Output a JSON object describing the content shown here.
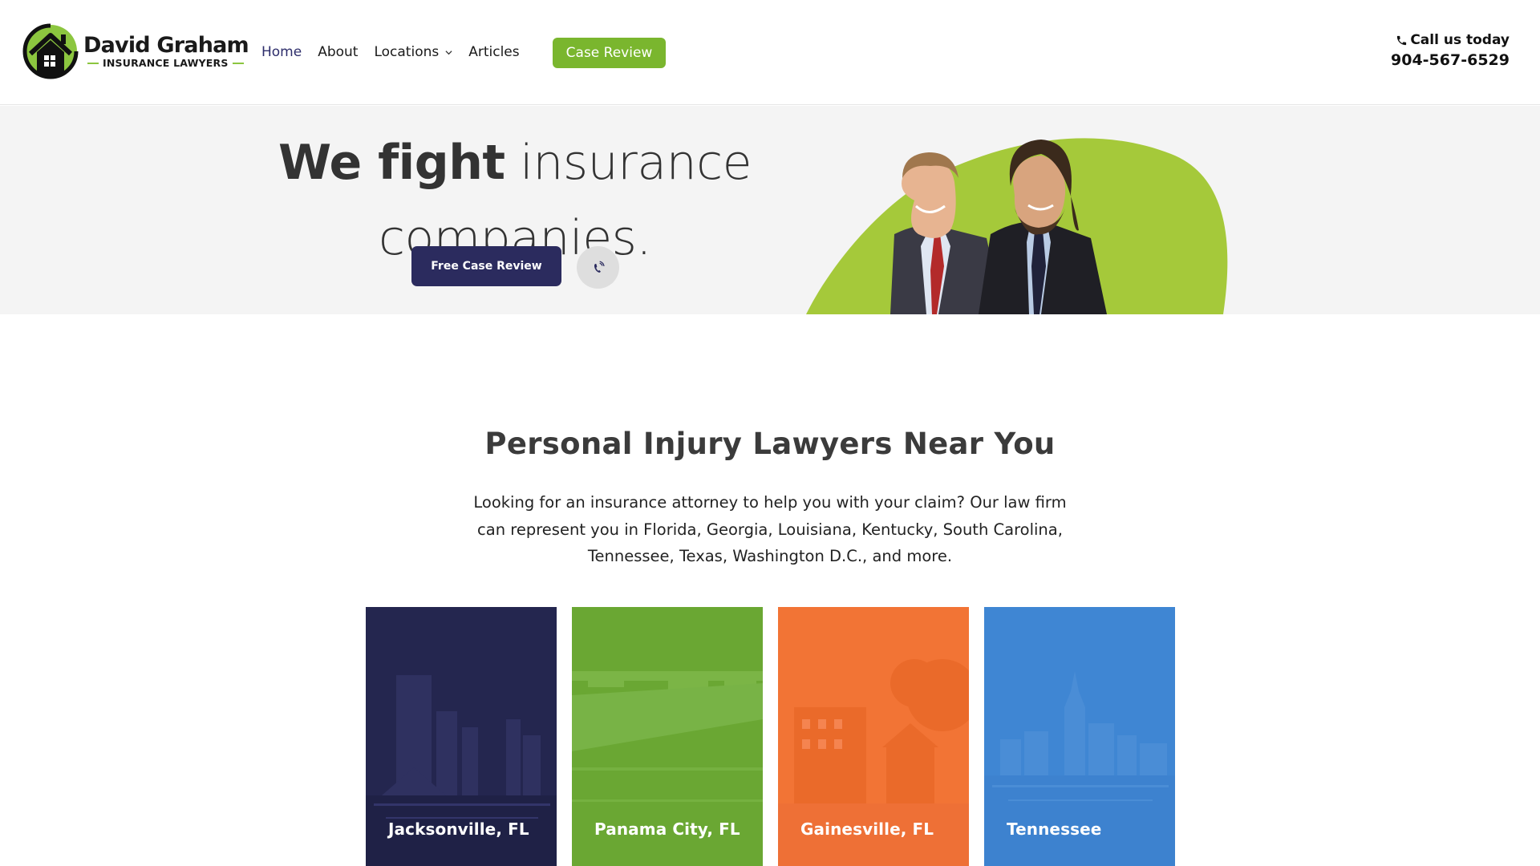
{
  "header": {
    "logo": {
      "name": "David Graham",
      "sub": "INSURANCE LAWYERS"
    },
    "nav": [
      {
        "label": "Home",
        "active": true
      },
      {
        "label": "About"
      },
      {
        "label": "Locations",
        "has_dropdown": true
      },
      {
        "label": "Articles"
      }
    ],
    "cta_label": "Case Review",
    "call_label": "Call us today",
    "call_phone": "904-567-6529"
  },
  "hero": {
    "title_bold": "We fight",
    "title_light": "insurance",
    "title_line2": "companies.",
    "primary_button": "Free Case Review",
    "phone_icon": "phone-ringing-icon"
  },
  "section": {
    "title": "Personal Injury Lawyers Near You",
    "body": "Looking for an insurance attorney to help you with your claim? Our law firm can represent you in Florida, Georgia, Louisiana, Kentucky, South Carolina, Tennessee, Texas, Washington D.C., and more."
  },
  "locations": [
    {
      "label": "Jacksonville, FL",
      "color": "#24264f"
    },
    {
      "label": "Panama City, FL",
      "color": "#6aa733"
    },
    {
      "label": "Gainesville, FL",
      "color": "#f27435"
    },
    {
      "label": "Tennessee",
      "color": "#3f86d3"
    }
  ],
  "colors": {
    "brand_green": "#7ab62e",
    "brand_navy": "#2b2b5e",
    "hero_bg": "#f4f4f4"
  }
}
